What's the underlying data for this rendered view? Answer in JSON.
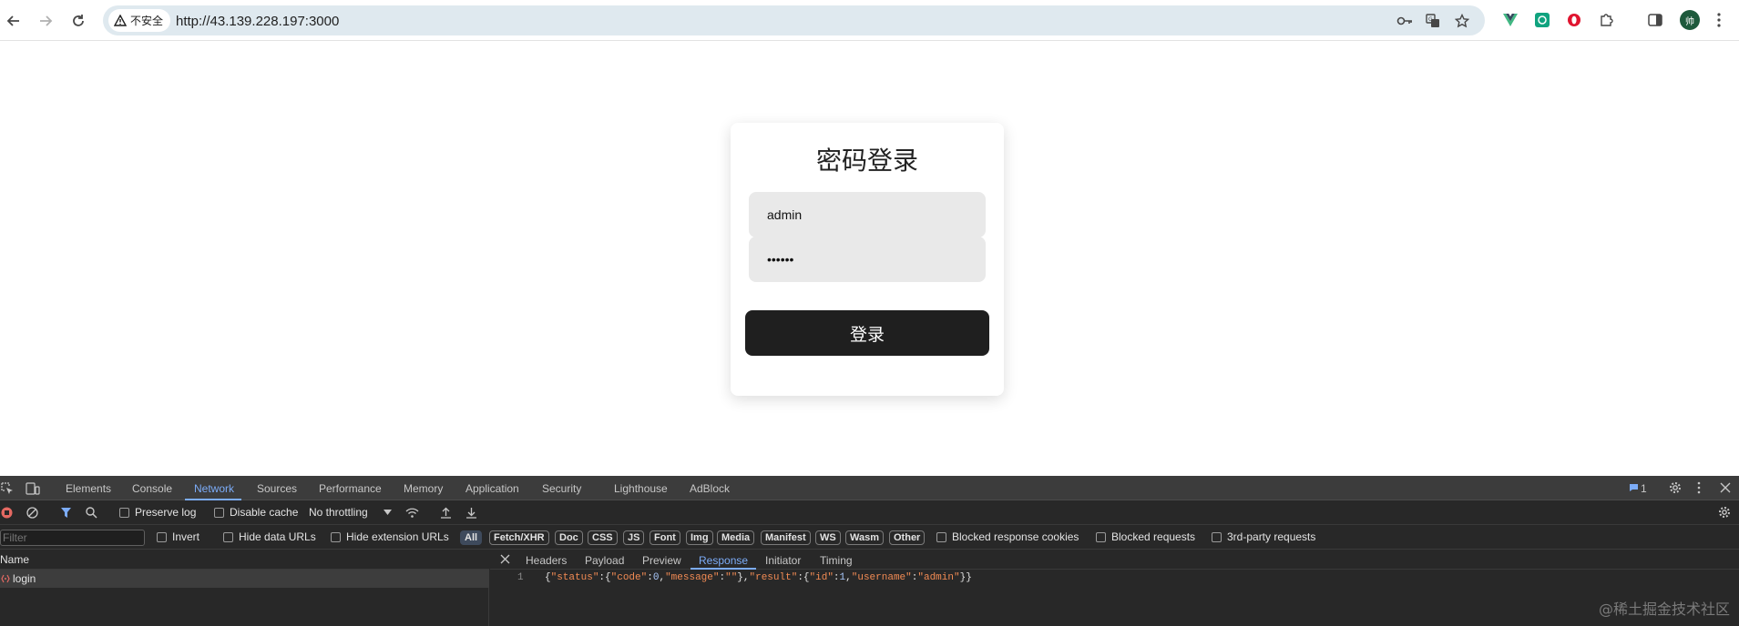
{
  "browser": {
    "security_chip": "不安全",
    "url": "http://43.139.228.197:3000",
    "profile_initial": "帅"
  },
  "page": {
    "title": "密码登录",
    "username_value": "admin",
    "password_value": "••••••",
    "login_label": "登录"
  },
  "devtools": {
    "tabs": [
      "Elements",
      "Console",
      "Network",
      "Sources",
      "Performance",
      "Memory",
      "Application",
      "Security",
      "Lighthouse",
      "AdBlock"
    ],
    "active_tab": "Network",
    "issues_count": "1",
    "toolbar": {
      "preserve_log": "Preserve log",
      "disable_cache": "Disable cache",
      "throttling": "No throttling"
    },
    "filterbar": {
      "filter_placeholder": "Filter",
      "invert": "Invert",
      "hide_data_urls": "Hide data URLs",
      "hide_extension_urls": "Hide extension URLs",
      "types": [
        "All",
        "Fetch/XHR",
        "Doc",
        "CSS",
        "JS",
        "Font",
        "Img",
        "Media",
        "Manifest",
        "WS",
        "Wasm",
        "Other"
      ],
      "blocked_cookies": "Blocked response cookies",
      "blocked_requests": "Blocked requests",
      "third_party": "3rd-party requests"
    },
    "request_list": {
      "header": "Name",
      "rows": [
        "login"
      ]
    },
    "detail_tabs": [
      "Headers",
      "Payload",
      "Preview",
      "Response",
      "Initiator",
      "Timing"
    ],
    "active_detail_tab": "Response",
    "response": {
      "line_number": "1",
      "tokens": [
        {
          "t": "{",
          "c": "p"
        },
        {
          "t": "\"status\"",
          "c": "k"
        },
        {
          "t": ":{",
          "c": "p"
        },
        {
          "t": "\"code\"",
          "c": "k"
        },
        {
          "t": ":",
          "c": "p"
        },
        {
          "t": "0",
          "c": "n"
        },
        {
          "t": ",",
          "c": "p"
        },
        {
          "t": "\"message\"",
          "c": "k"
        },
        {
          "t": ":",
          "c": "p"
        },
        {
          "t": "\"\"",
          "c": "s"
        },
        {
          "t": "},",
          "c": "p"
        },
        {
          "t": "\"result\"",
          "c": "k"
        },
        {
          "t": ":{",
          "c": "p"
        },
        {
          "t": "\"id\"",
          "c": "k"
        },
        {
          "t": ":",
          "c": "p"
        },
        {
          "t": "1",
          "c": "n"
        },
        {
          "t": ",",
          "c": "p"
        },
        {
          "t": "\"username\"",
          "c": "k"
        },
        {
          "t": ":",
          "c": "p"
        },
        {
          "t": "\"admin\"",
          "c": "s"
        },
        {
          "t": "}}",
          "c": "p"
        }
      ]
    }
  },
  "watermark": "@稀土掘金技术社区",
  "colors": {
    "active_blue": "#7cacf8",
    "button_dark": "#1f1f1f",
    "json_key": "#f28b54",
    "json_number": "#a8c7fa"
  }
}
